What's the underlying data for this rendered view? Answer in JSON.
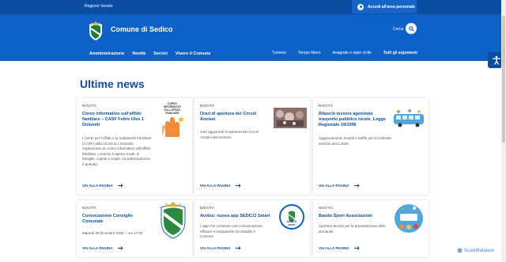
{
  "topbar": {
    "region": "Regione Veneto",
    "login_label": "Accedi all'area personale"
  },
  "header": {
    "site_title": "Comune di Sedico",
    "search_label": "Cerca"
  },
  "nav_main": [
    "Amministrazione",
    "Novità",
    "Servizi",
    "Vivere il Comune"
  ],
  "nav_secondary": [
    "Turismo",
    "Tempo libero",
    "Anagrafe e stato civile",
    "Tutti gli argomenti"
  ],
  "section": {
    "title": "Ultime news"
  },
  "cards": [
    {
      "category": "NOVITÀ",
      "title": "Corso informativo sull'affido familiare – CASF Feltre Ulss 1 Dolomiti",
      "desc": "I Centri per l'Affido e la Solidarietà Familiare (CASF) della ULSS N.1 Dolomiti organizzano un corso informativo sull'affido familiare. L'evento è aperto a tutti: le famiglie, coppie e single. La partecipazione è gratuita.",
      "more": "VAI ALLA PAGINA",
      "thumb_text": "CORSO INFORMATIVO SULL'AFFIDO FAMILIARE"
    },
    {
      "category": "NOVITÀ",
      "title": "Orari di apertura dei Circoli Anziani",
      "desc": "orari aggiornati di apertura dei Circoli Anziani del territorio",
      "more": "VAI ALLA PAGINA"
    },
    {
      "category": "NOVITÀ",
      "title": "Rilascio tessere agevolate trasporto pubblico locale_Legge Regionale 19/1996",
      "desc": "Aggiornamento moduli e tariffe per la richiesta servizio anno 2026",
      "more": "VAI ALLA PAGINA"
    },
    {
      "category": "NOVITÀ",
      "title": "Convocazione Consiglio Comunale",
      "desc": "Martedì 30 dicembre 2025 – ore 17:00",
      "more": "VAI ALLA PAGINA"
    },
    {
      "category": "NOVITÀ",
      "title": "Avviso: nuova app SEDICO Smart",
      "desc": "L'app che consente una comunicazione efficace e trasparente tra cittadini e Comune",
      "more": "VAI ALLA PAGINA",
      "thumb_text": "SEDICO smart"
    },
    {
      "category": "NOVITÀ",
      "title": "Bando Sport Associazioni",
      "desc": "Apertura termini per la presentazione delle domande",
      "more": "VAI ALLA PAGINA"
    }
  ],
  "watermark": "ScanMalware",
  "colors": {
    "primary": "#0e61c7",
    "dark": "#0b4da2",
    "title_blue": "#0e4e9e"
  },
  "icons": [
    "user-icon",
    "search-icon",
    "accessibility-icon",
    "arrow-right-icon",
    "crest-icon"
  ]
}
